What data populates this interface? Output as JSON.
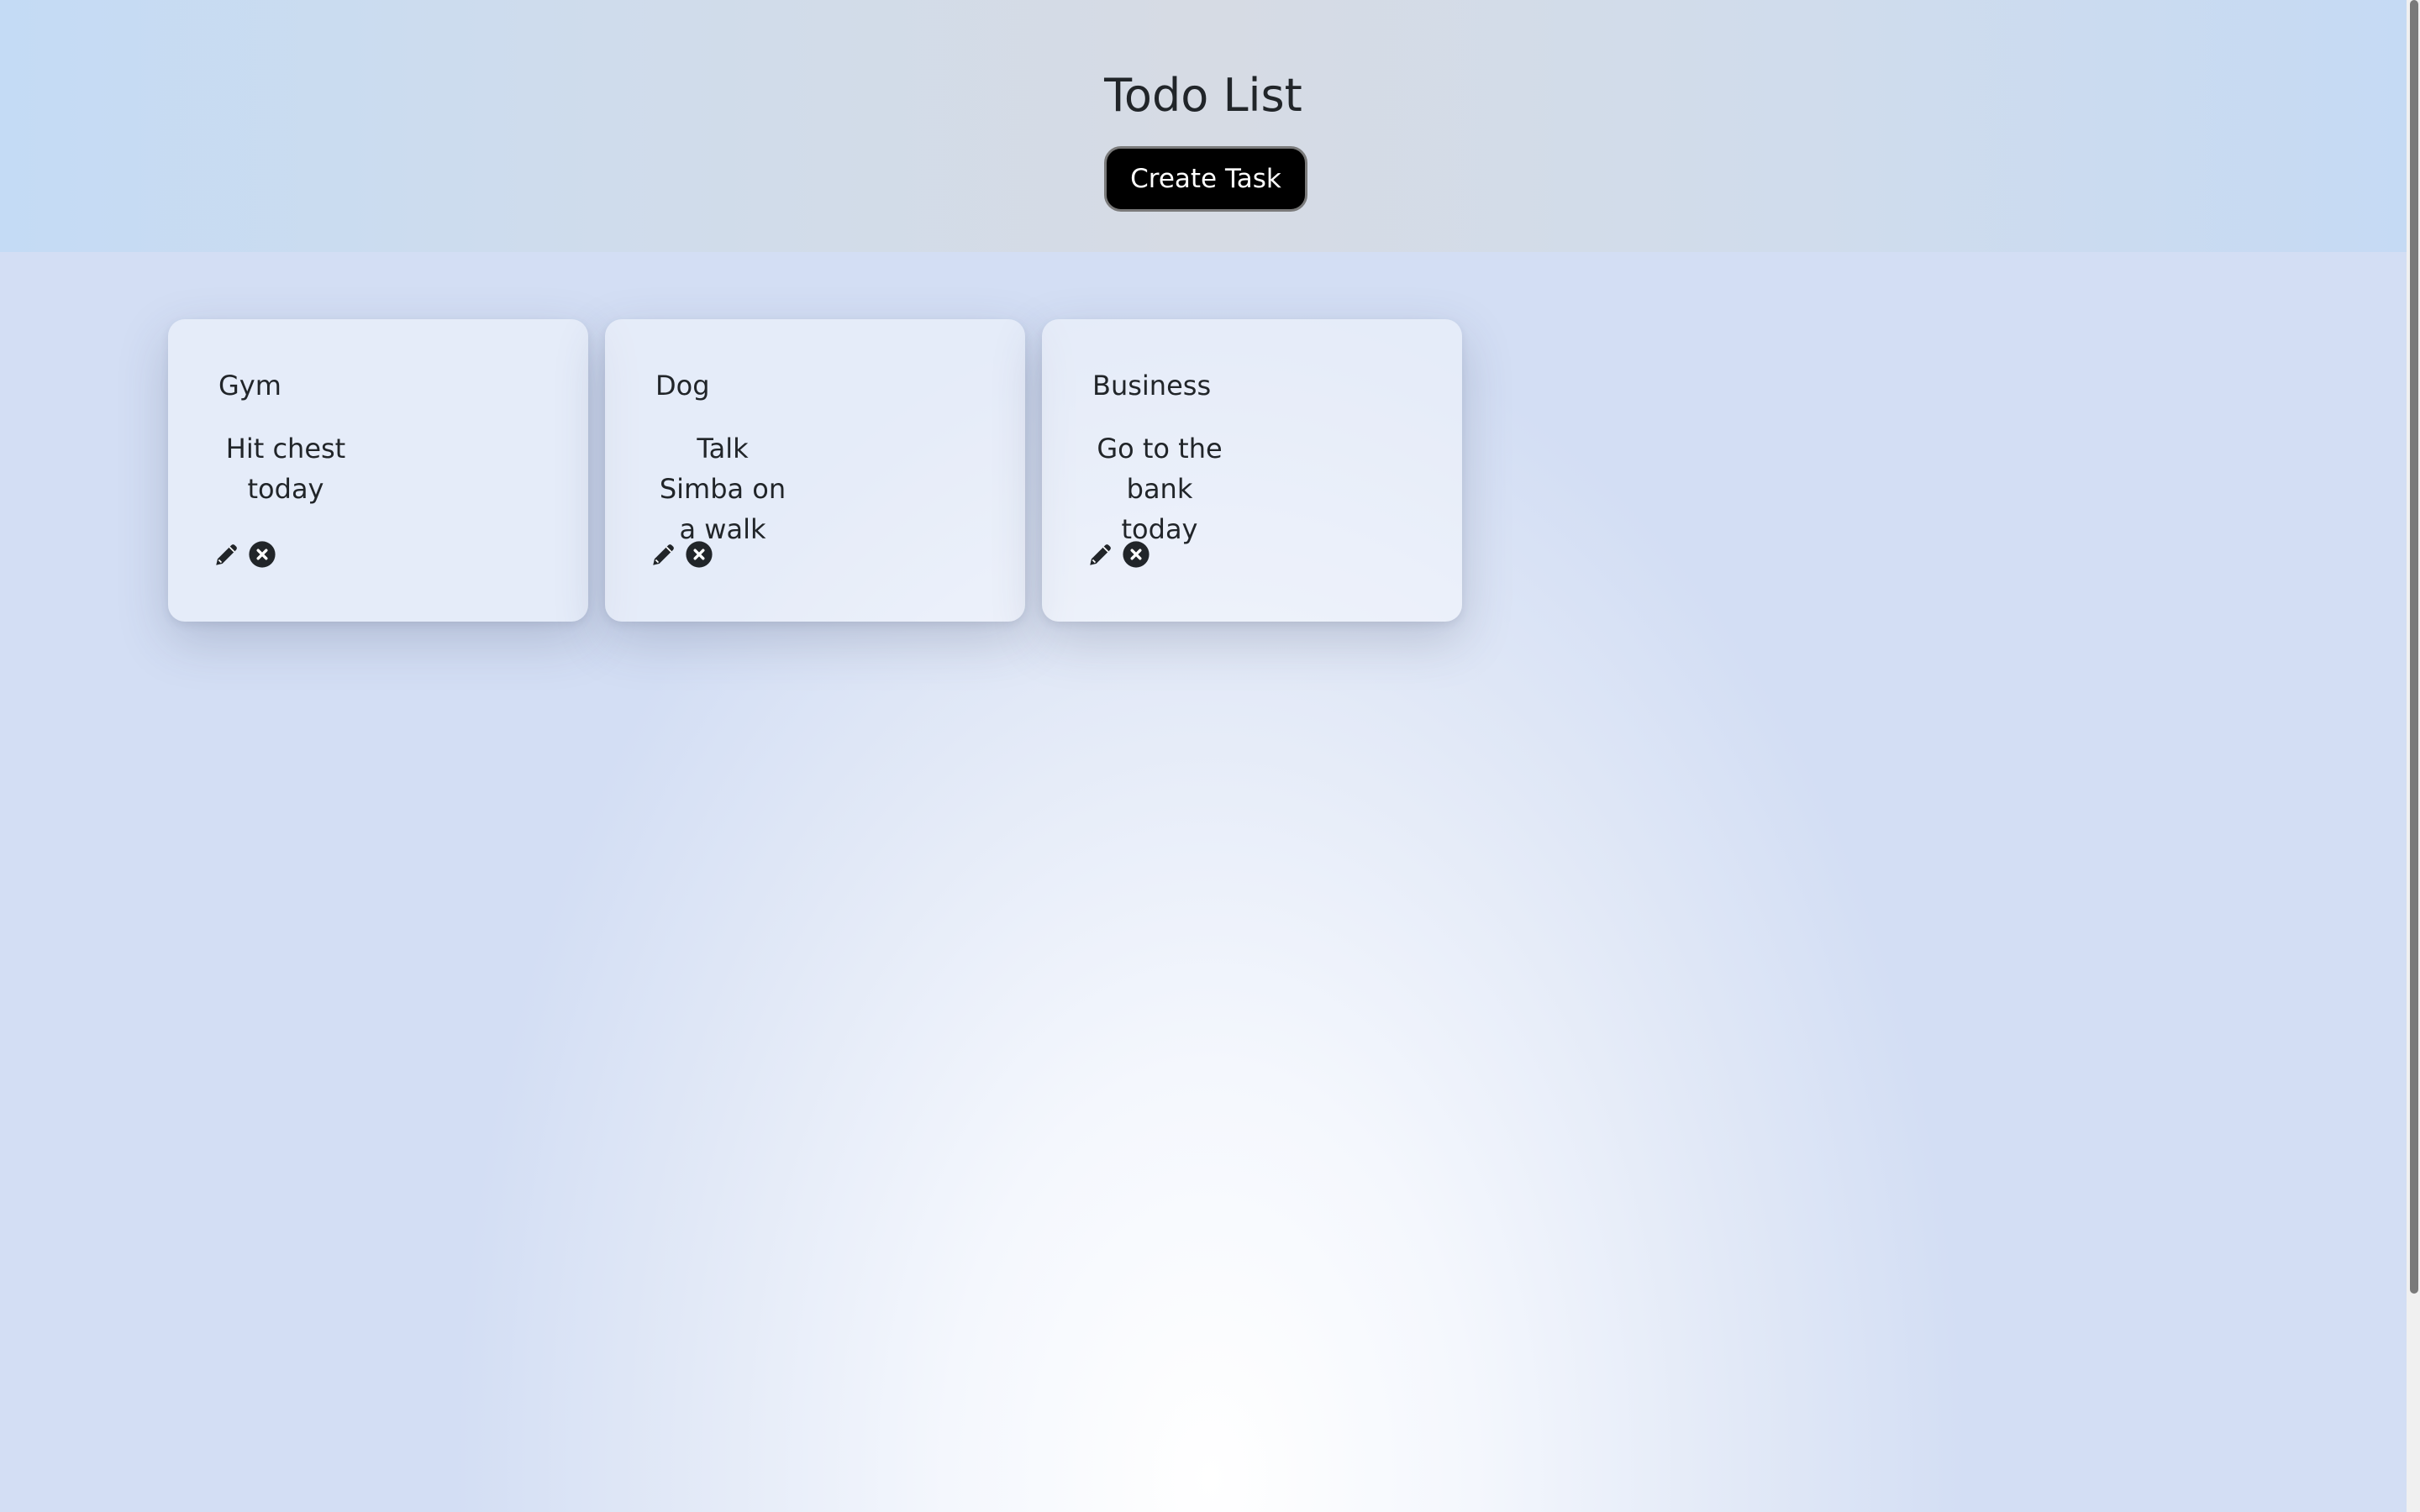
{
  "header": {
    "title": "Todo List",
    "create_button_label": "Create Task"
  },
  "tasks": [
    {
      "title": "Gym",
      "description": "Hit chest today",
      "edit_icon": "pencil-icon",
      "delete_icon": "times-circle-icon"
    },
    {
      "title": "Dog",
      "description": "Talk Simba on a walk",
      "edit_icon": "pencil-icon",
      "delete_icon": "times-circle-icon"
    },
    {
      "title": "Business",
      "description": "Go to the bank today",
      "edit_icon": "pencil-icon",
      "delete_icon": "times-circle-icon"
    }
  ],
  "colors": {
    "button_bg": "#000000",
    "button_text": "#ffffff",
    "text": "#212529",
    "header_bg": "#d0dcec"
  }
}
